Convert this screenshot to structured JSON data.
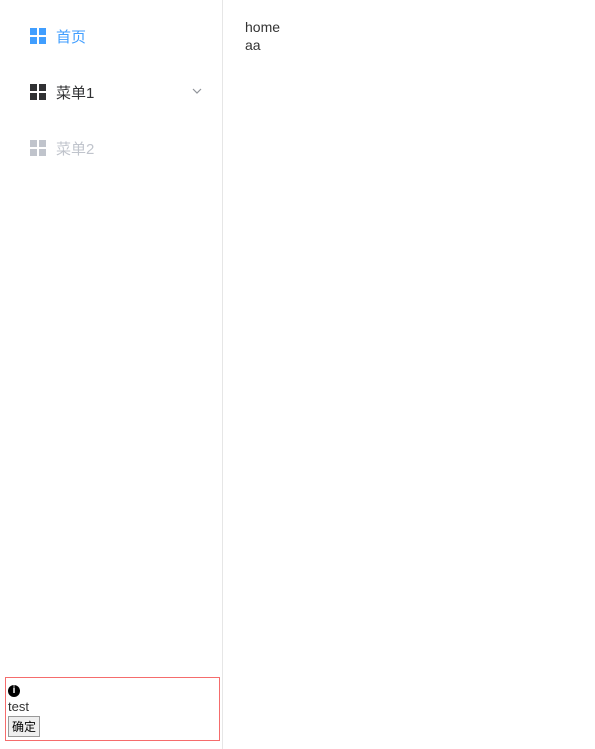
{
  "sidebar": {
    "items": [
      {
        "label": "首页",
        "icon": "grid-icon",
        "active": true,
        "disabled": false,
        "hasChildren": false
      },
      {
        "label": "菜单1",
        "icon": "grid-icon",
        "active": false,
        "disabled": false,
        "hasChildren": true
      },
      {
        "label": "菜单2",
        "icon": "grid-icon",
        "active": false,
        "disabled": true,
        "hasChildren": false
      }
    ]
  },
  "main": {
    "line1": "home",
    "line2": "aa"
  },
  "dialog": {
    "icon": "info-icon",
    "message": "test",
    "confirm_label": "确定"
  },
  "colors": {
    "primary": "#409EFF",
    "danger_border": "#f56c6c",
    "text_disabled": "#c0c4cc"
  }
}
